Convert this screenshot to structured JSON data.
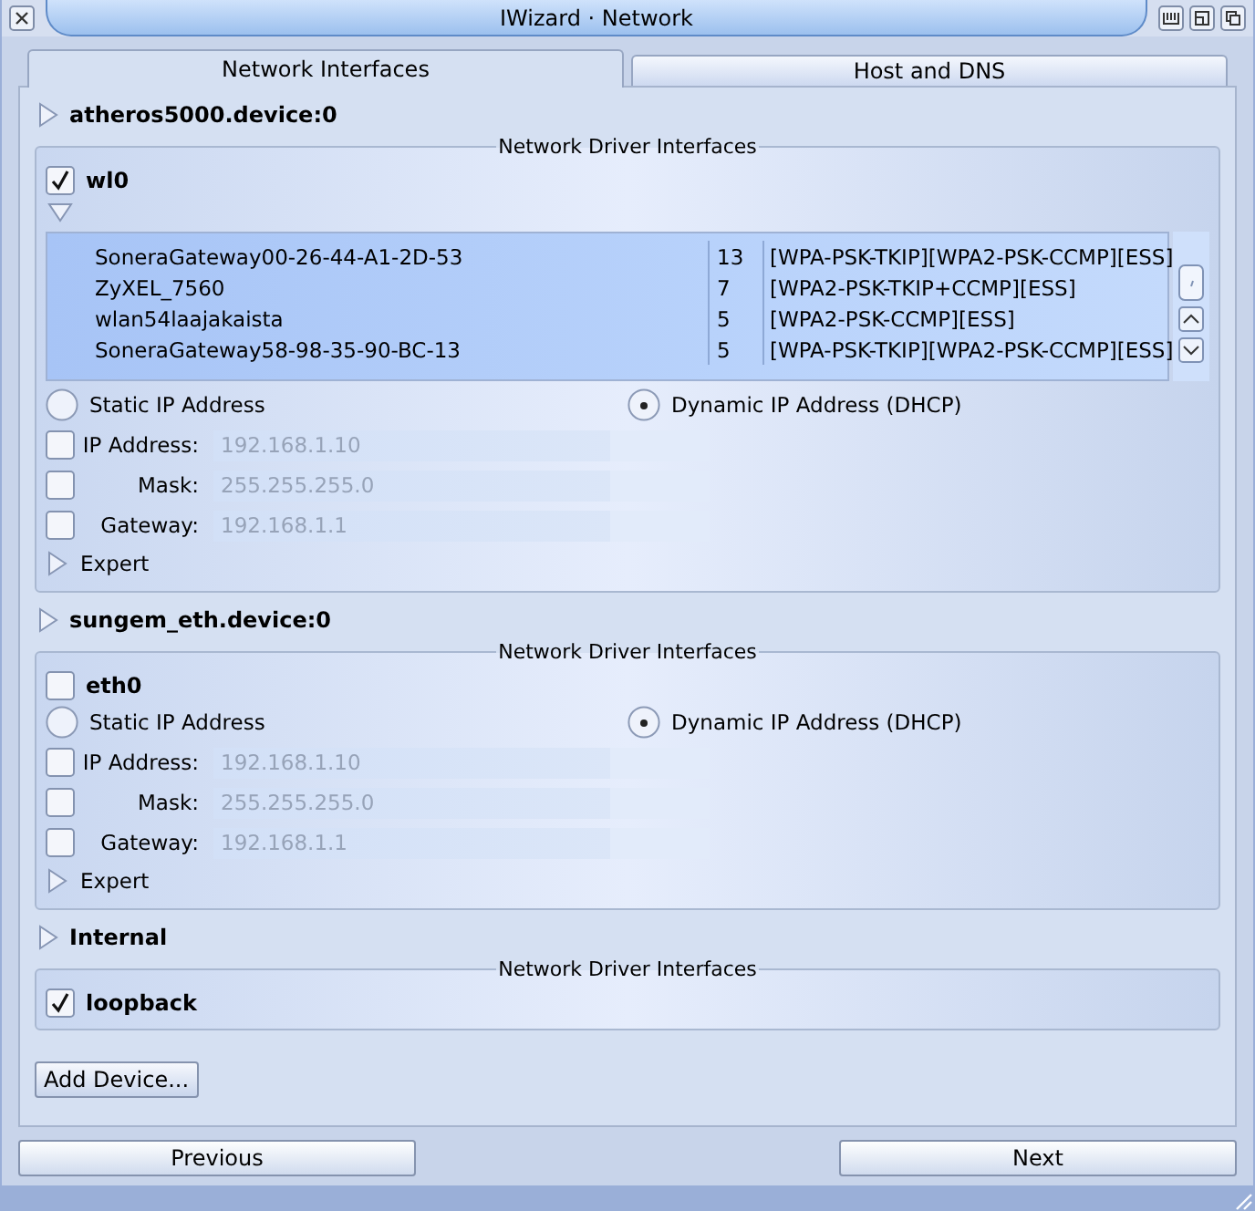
{
  "window": {
    "title": "IWizard · Network"
  },
  "tabs": [
    {
      "label": "Network Interfaces",
      "selected": true
    },
    {
      "label": "Host and DNS",
      "selected": false
    }
  ],
  "devices": [
    {
      "name": "atheros5000.device:0",
      "group_title": "Network Driver Interfaces",
      "interfaces": [
        {
          "name": "wl0",
          "checked": true,
          "networks_expanded": true,
          "networks": [
            {
              "ssid": "SoneraGateway00-26-44-A1-2D-53",
              "channel": "13",
              "flags": "[WPA-PSK-TKIP][WPA2-PSK-CCMP][ESS]",
              "selected": true
            },
            {
              "ssid": "ZyXEL_7560",
              "channel": "7",
              "flags": "[WPA2-PSK-TKIP+CCMP][ESS]",
              "selected": true
            },
            {
              "ssid": "wlan54laajakaista",
              "channel": "5",
              "flags": "[WPA2-PSK-CCMP][ESS]",
              "selected": true
            },
            {
              "ssid": "SoneraGateway58-98-35-90-BC-13",
              "channel": "5",
              "flags": "[WPA-PSK-TKIP][WPA2-PSK-CCMP][ESS]",
              "selected": true
            }
          ],
          "ip_modes": [
            {
              "label": "Static IP Address",
              "selected": false
            },
            {
              "label": "Dynamic IP Address (DHCP)",
              "selected": true
            }
          ],
          "fields": [
            {
              "label": "IP Address:",
              "value": "192.168.1.10",
              "checked": false,
              "disabled": true
            },
            {
              "label": "Mask:",
              "value": "255.255.255.0",
              "checked": false,
              "disabled": true
            },
            {
              "label": "Gateway:",
              "value": "192.168.1.1",
              "checked": false,
              "disabled": true
            }
          ],
          "expert": {
            "label": "Expert",
            "expanded": false
          }
        }
      ]
    },
    {
      "name": "sungem_eth.device:0",
      "group_title": "Network Driver Interfaces",
      "interfaces": [
        {
          "name": "eth0",
          "checked": false,
          "ip_modes": [
            {
              "label": "Static IP Address",
              "selected": false
            },
            {
              "label": "Dynamic IP Address (DHCP)",
              "selected": true
            }
          ],
          "fields": [
            {
              "label": "IP Address:",
              "value": "192.168.1.10",
              "checked": false,
              "disabled": true
            },
            {
              "label": "Mask:",
              "value": "255.255.255.0",
              "checked": false,
              "disabled": true
            },
            {
              "label": "Gateway:",
              "value": "192.168.1.1",
              "checked": false,
              "disabled": true
            }
          ],
          "expert": {
            "label": "Expert",
            "expanded": false
          }
        }
      ]
    },
    {
      "name": "Internal",
      "group_title": "Network Driver Interfaces",
      "interfaces": [
        {
          "name": "loopback",
          "checked": true
        }
      ]
    }
  ],
  "add_device": "Add Device...",
  "nav": {
    "previous": "Previous",
    "next": "Next"
  }
}
